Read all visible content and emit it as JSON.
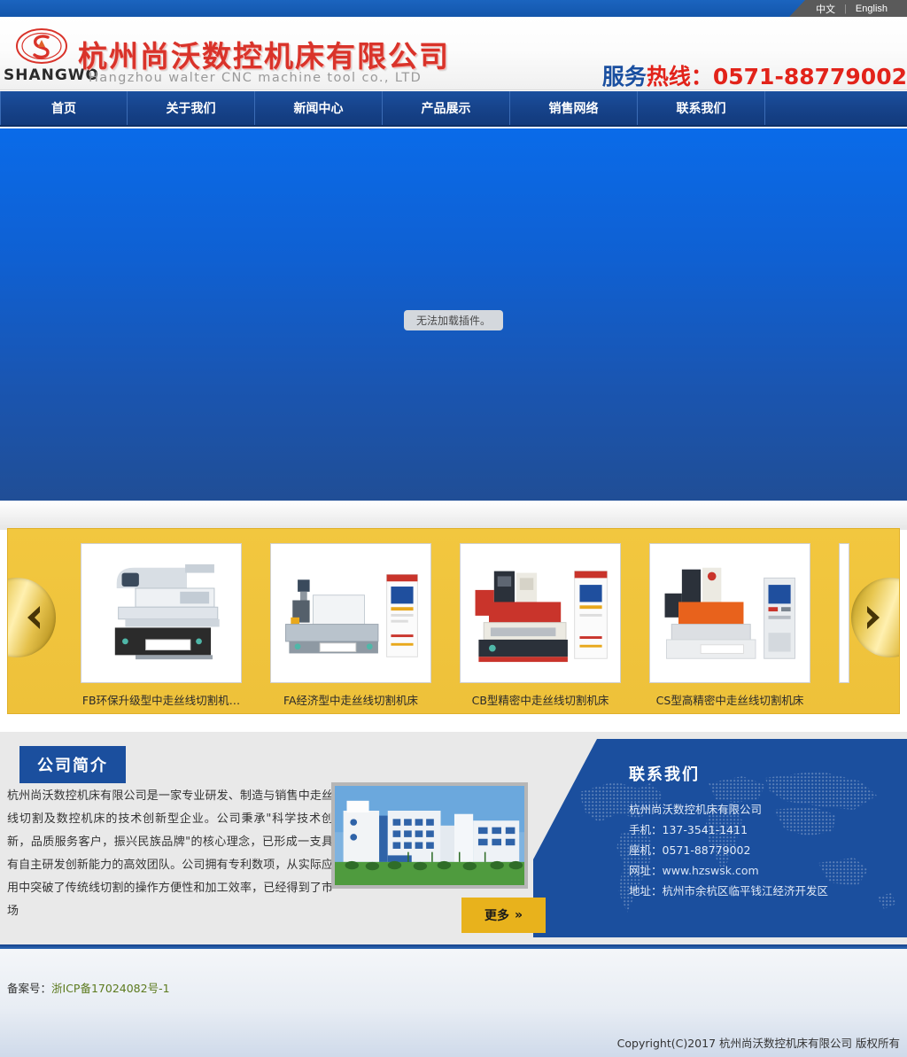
{
  "topbar": {
    "languages": [
      {
        "label": "中文",
        "active": true
      },
      {
        "label": "English",
        "active": false
      }
    ],
    "separator": "|"
  },
  "header": {
    "logo_word": "SHANGWO",
    "company_cn": "杭州尚沃数控机床有限公司",
    "company_en": "Hangzhou walter CNC machine tool co., LTD",
    "hotline_label_blue": "服务",
    "hotline_label_red": "热线",
    "hotline_colon": "：",
    "hotline_number": "0571-88779002"
  },
  "nav": {
    "items": [
      {
        "label": "首页"
      },
      {
        "label": "关于我们"
      },
      {
        "label": "新闻中心"
      },
      {
        "label": "产品展示"
      },
      {
        "label": "销售网络"
      },
      {
        "label": "联系我们"
      }
    ]
  },
  "banner": {
    "plugin_message": "无法加载插件。"
  },
  "carousel": {
    "prev_icon": "chevron-left-icon",
    "next_icon": "chevron-right-icon",
    "items": [
      {
        "caption": "FB环保升级型中走丝线切割机…"
      },
      {
        "caption": "FA经济型中走丝线切割机床"
      },
      {
        "caption": "CB型精密中走丝线切割机床"
      },
      {
        "caption": "CS型高精密中走丝线切割机床"
      },
      {
        "caption": ""
      }
    ]
  },
  "intro": {
    "title": "公司简介",
    "body": "杭州尚沃数控机床有限公司是一家专业研发、制造与销售中走丝线切割及数控机床的技术创新型企业。公司秉承\"科学技术创新，品质服务客户，振兴民族品牌\"的核心理念，已形成一支具有自主研发创新能力的高效团队。公司拥有专利数项，从实际应用中突破了传统线切割的操作方便性和加工效率，已经得到了市场",
    "more_label": "更多",
    "more_arrow": "»"
  },
  "contact": {
    "title": "联系我们",
    "company": "杭州尚沃数控机床有限公司",
    "mobile_label": "手机：",
    "mobile": "137-3541-1411",
    "tel_label": "座机：",
    "tel": "0571-88779002",
    "web_label": "网址：",
    "web": "www.hzswsk.com",
    "addr_label": "地址：",
    "addr": "杭州市余杭区临平钱江经济开发区"
  },
  "footer": {
    "icp_label": "备案号：",
    "icp_link": "浙ICP备17024082号-1",
    "copyright": "Copyright(C)2017 杭州尚沃数控机床有限公司 版权所有"
  },
  "colors": {
    "nav_blue": "#1b4f9e",
    "brand_red": "#d9332a",
    "gold": "#f2c73f",
    "accent_gold_btn": "#e8b21c",
    "banner_blue": "#0a6be9"
  }
}
